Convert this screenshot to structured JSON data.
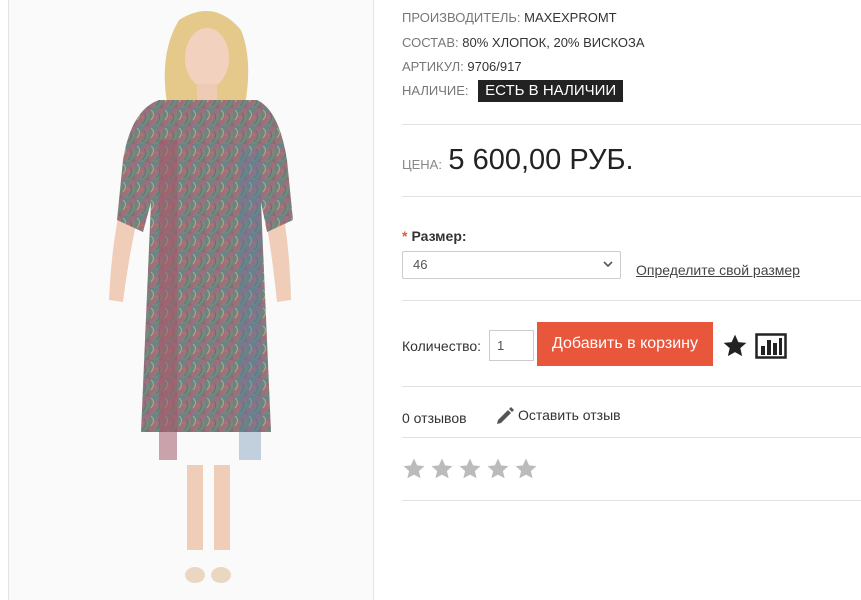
{
  "product": {
    "manufacturer_label": "ПРОИЗВОДИТЕЛЬ:",
    "manufacturer_value": "MAXEXPROMT",
    "composition_label": "СОСТАВ:",
    "composition_value": "80% ХЛОПОК, 20% ВИСКОЗА",
    "sku_label": "АРТИКУЛ:",
    "sku_value": "9706/917",
    "availability_label": "НАЛИЧИЕ:",
    "availability_value": "ЕСТЬ В НАЛИЧИИ",
    "price_label": "ЦЕНА:",
    "price_value": "5 600,00 РУБ."
  },
  "options": {
    "required_mark": "*",
    "size_label": "Размер:",
    "size_selected": "46",
    "size_guide_link": "Определите свой размер"
  },
  "cart": {
    "quantity_label": "Количество:",
    "quantity_value": "1",
    "add_to_cart_label": "Добавить в корзину",
    "wishlist_icon": "star-icon",
    "compare_icon": "bar-chart-icon"
  },
  "reviews": {
    "count_text": "0 отзывов",
    "write_review_label": "Оставить отзыв",
    "rating_stars": 5,
    "rating_value": 0
  },
  "colors": {
    "accent": "#e8563b",
    "badge_bg": "#222222",
    "star_empty": "#bbbbbb"
  }
}
